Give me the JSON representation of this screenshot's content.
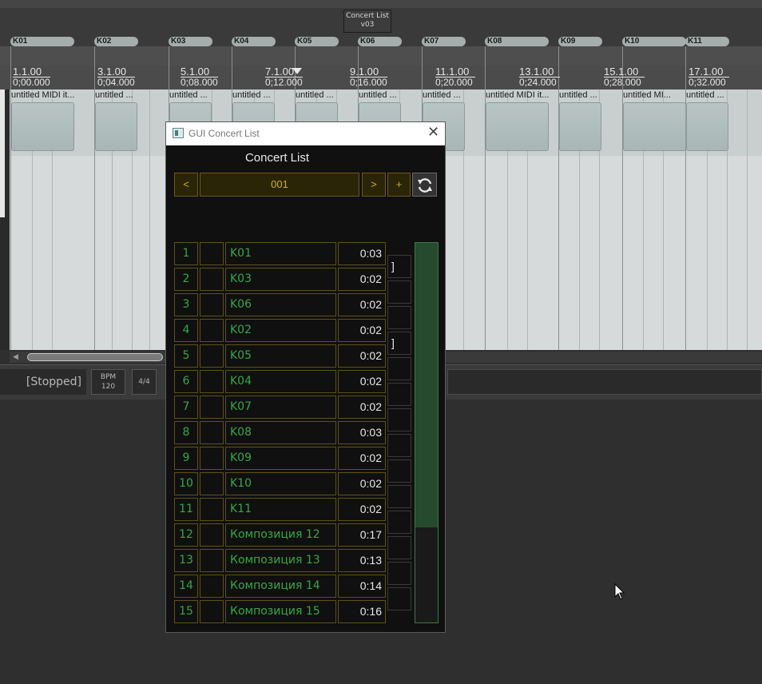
{
  "project_badge": {
    "line1": "Concert List",
    "line2": "v03"
  },
  "markers": [
    {
      "label": "K01"
    },
    {
      "label": "K02"
    },
    {
      "label": "K03"
    },
    {
      "label": "K04"
    },
    {
      "label": "K05"
    },
    {
      "label": "K06"
    },
    {
      "label": "K07"
    },
    {
      "label": "K08"
    },
    {
      "label": "K09"
    },
    {
      "label": "K10"
    },
    {
      "label": "K11"
    }
  ],
  "ruler": [
    {
      "beat": "1.1.00",
      "time": "0;00.000"
    },
    {
      "beat": "3.1.00",
      "time": "0;04.000"
    },
    {
      "beat": "5.1.00",
      "time": "0;08.000"
    },
    {
      "beat": "7.1.00",
      "time": "0;12.000"
    },
    {
      "beat": "9.1.00",
      "time": "0;16.000"
    },
    {
      "beat": "11.1.00",
      "time": "0;20.000"
    },
    {
      "beat": "13.1.00",
      "time": "0;24.000"
    },
    {
      "beat": "15.1.00",
      "time": "0;28.000"
    },
    {
      "beat": "17.1.00",
      "time": "0;32.000"
    }
  ],
  "items": [
    {
      "label": "untitled MIDI it..."
    },
    {
      "label": "untitled ..."
    },
    {
      "label": "untitled ..."
    },
    {
      "label": "untitled ..."
    },
    {
      "label": "untitled ..."
    },
    {
      "label": "untitled ..."
    },
    {
      "label": "untitled ..."
    },
    {
      "label": "untitled MIDI it..."
    },
    {
      "label": "untitled ..."
    },
    {
      "label": "untitled MI..."
    },
    {
      "label": "untitled ..."
    }
  ],
  "transport": {
    "status": "[Stopped]",
    "bpm_label": "BPM",
    "bpm_value": "120",
    "time_sig": "4/4"
  },
  "window": {
    "title": "GUI Concert List",
    "close_glyph": "✕",
    "heading": "Concert List",
    "prev_label": "<",
    "set_number": "001",
    "next_label": ">",
    "add_label": "+"
  },
  "rows": [
    {
      "num": "1",
      "name": "K01",
      "time": "0:03",
      "flag": "]"
    },
    {
      "num": "2",
      "name": "K03",
      "time": "0:02",
      "flag": ""
    },
    {
      "num": "3",
      "name": "K06",
      "time": "0:02",
      "flag": ""
    },
    {
      "num": "4",
      "name": "K02",
      "time": "0:02",
      "flag": "]"
    },
    {
      "num": "5",
      "name": "K05",
      "time": "0:02",
      "flag": ""
    },
    {
      "num": "6",
      "name": "K04",
      "time": "0:02",
      "flag": ""
    },
    {
      "num": "7",
      "name": "K07",
      "time": "0:02",
      "flag": ""
    },
    {
      "num": "8",
      "name": "K08",
      "time": "0:03",
      "flag": ""
    },
    {
      "num": "9",
      "name": "K09",
      "time": "0:02",
      "flag": ""
    },
    {
      "num": "10",
      "name": "K10",
      "time": "0:02",
      "flag": ""
    },
    {
      "num": "11",
      "name": "K11",
      "time": "0:02",
      "flag": ""
    },
    {
      "num": "12",
      "name": "Композиция 12",
      "time": "0:17",
      "flag": ""
    },
    {
      "num": "13",
      "name": "Композиция 13",
      "time": "0:13",
      "flag": ""
    },
    {
      "num": "14",
      "name": "Композиция 14",
      "time": "0:14",
      "flag": ""
    },
    {
      "num": "15",
      "name": "Композиция 15",
      "time": "0:16",
      "flag": ""
    }
  ],
  "scroll": {
    "position_fraction": 0,
    "visible_fraction": 0.75
  },
  "colors": {
    "accent_gold": "#d2b020",
    "list_green": "#35a845",
    "scroll_green": "#3d7a45"
  },
  "icons": {
    "refresh": "refresh-icon",
    "cursor": "mouse-pointer-icon",
    "window": "app-window-icon"
  }
}
